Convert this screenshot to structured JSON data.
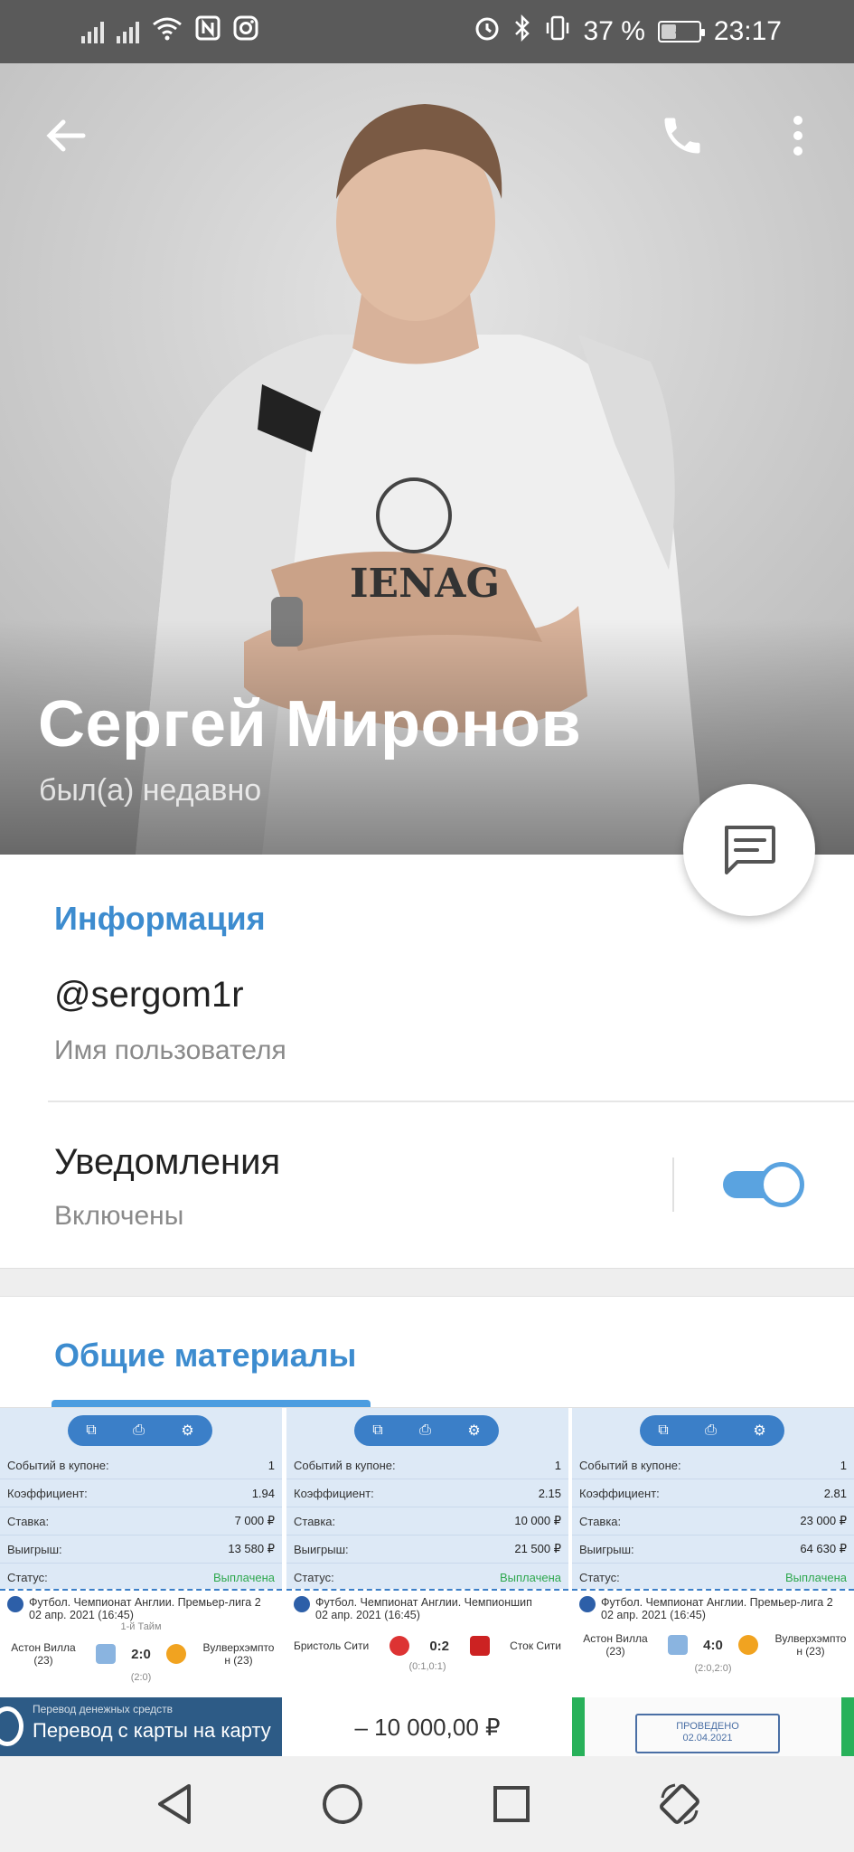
{
  "status_bar": {
    "battery_percent": "37 %",
    "time": "23:17",
    "icons": [
      "signal-icon",
      "signal-icon",
      "wifi-icon",
      "nfc-icon",
      "instagram-icon",
      "alarm-icon",
      "bluetooth-icon",
      "vibrate-icon",
      "battery-icon"
    ]
  },
  "profile": {
    "name": "Сергей Миронов",
    "last_seen": "был(а) недавно"
  },
  "info": {
    "section_title": "Информация",
    "username": "@sergom1r",
    "username_label": "Имя пользователя",
    "notifications_label": "Уведомления",
    "notifications_state": "Включены",
    "notifications_enabled": true
  },
  "shared_media": {
    "section_title": "Общие материалы",
    "items": [
      {
        "rows": [
          {
            "label": "Событий в купоне:",
            "value": "1"
          },
          {
            "label": "Коэффициент:",
            "value": "1.94"
          },
          {
            "label": "Ставка:",
            "value": "7 000 ₽"
          },
          {
            "label": "Выигрыш:",
            "value": "13 580 ₽"
          },
          {
            "label": "Статус:",
            "value": "Выплачена"
          }
        ],
        "league": "Футбол. Чемпионат Англии. Премьер-лига 2",
        "date": "02 апр. 2021 (16:45)",
        "period": "1-й Тайм",
        "home": "Астон Вилла (23)",
        "away": "Вулверхэмпто н (23)",
        "score": "2:0",
        "subscore": "(2:0)"
      },
      {
        "rows": [
          {
            "label": "Событий в купоне:",
            "value": "1"
          },
          {
            "label": "Коэффициент:",
            "value": "2.15"
          },
          {
            "label": "Ставка:",
            "value": "10 000 ₽"
          },
          {
            "label": "Выигрыш:",
            "value": "21 500 ₽"
          },
          {
            "label": "Статус:",
            "value": "Выплачена"
          }
        ],
        "league": "Футбол. Чемпионат Англии. Чемпионшип",
        "date": "02 апр. 2021 (16:45)",
        "period": "",
        "home": "Бристоль Сити",
        "away": "Сток Сити",
        "score": "0:2",
        "subscore": "(0:1,0:1)"
      },
      {
        "rows": [
          {
            "label": "Событий в купоне:",
            "value": "1"
          },
          {
            "label": "Коэффициент:",
            "value": "2.81"
          },
          {
            "label": "Ставка:",
            "value": "23 000 ₽"
          },
          {
            "label": "Выигрыш:",
            "value": "64 630 ₽"
          },
          {
            "label": "Статус:",
            "value": "Выплачена"
          }
        ],
        "league": "Футбол. Чемпионат Англии. Премьер-лига 2",
        "date": "02 апр. 2021 (16:45)",
        "period": "",
        "home": "Астон Вилла (23)",
        "away": "Вулверхэмпто н (23)",
        "score": "4:0",
        "subscore": "(2:0,2:0)"
      }
    ],
    "strip_transfer_small": "Перевод денежных средств",
    "strip_transfer_big": "Перевод с карты на карту",
    "strip_amount": "– 10 000,00 ₽",
    "strip_stamp_line1": "ПРОВЕДЕНО",
    "strip_stamp_line2": "02.04.2021"
  },
  "colors": {
    "accent": "#3d8ccf",
    "status_bar": "#5a5a5a",
    "toggle_on": "#5aa3e0",
    "paid_green": "#2fa84f"
  }
}
